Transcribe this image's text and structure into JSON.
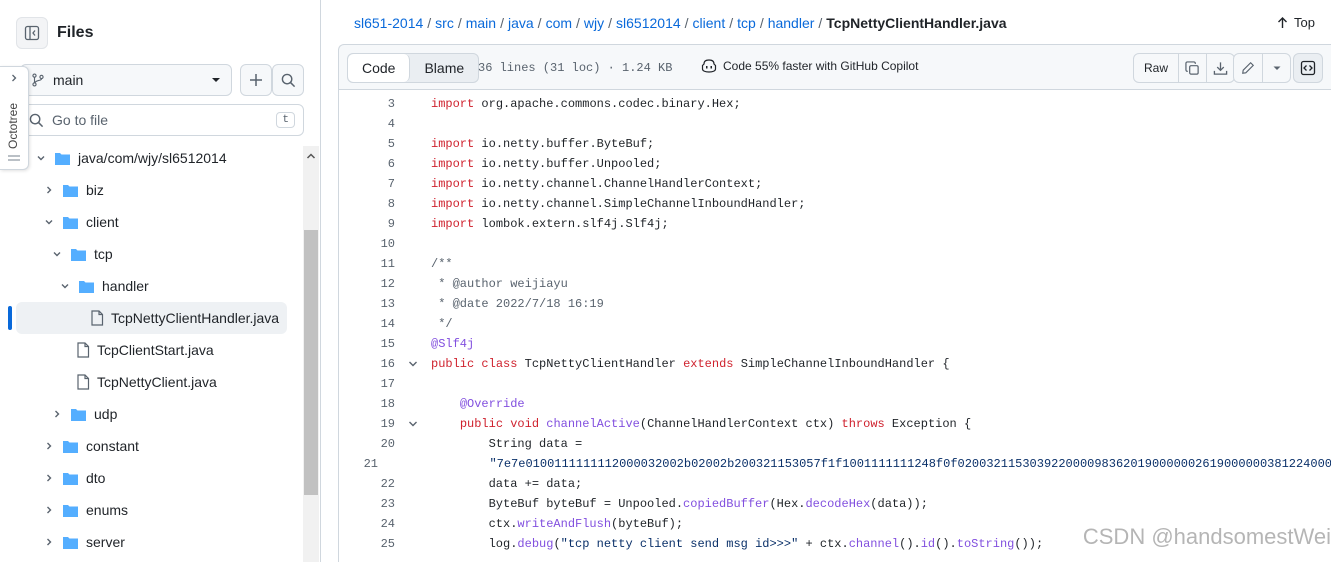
{
  "sidebar": {
    "title": "Files",
    "branch": "main",
    "search_placeholder": "Go to file",
    "search_shortcut": "t",
    "octotree_label": "Octotree",
    "tree": [
      {
        "label": "java/com/wjy/sl6512014",
        "type": "folder",
        "expanded": true
      },
      {
        "label": "biz",
        "type": "folder",
        "expanded": false
      },
      {
        "label": "client",
        "type": "folder",
        "expanded": true
      },
      {
        "label": "tcp",
        "type": "folder",
        "expanded": true
      },
      {
        "label": "handler",
        "type": "folder",
        "expanded": true
      },
      {
        "label": "TcpNettyClientHandler.java",
        "type": "file",
        "selected": true
      },
      {
        "label": "TcpClientStart.java",
        "type": "file"
      },
      {
        "label": "TcpNettyClient.java",
        "type": "file"
      },
      {
        "label": "udp",
        "type": "folder",
        "expanded": false
      },
      {
        "label": "constant",
        "type": "folder",
        "expanded": false
      },
      {
        "label": "dto",
        "type": "folder",
        "expanded": false
      },
      {
        "label": "enums",
        "type": "folder",
        "expanded": false
      },
      {
        "label": "server",
        "type": "folder",
        "expanded": false
      }
    ]
  },
  "breadcrumb": {
    "parts": [
      "sl651-2014",
      "src",
      "main",
      "java",
      "com",
      "wjy",
      "sl6512014",
      "client",
      "tcp",
      "handler"
    ],
    "current": "TcpNettyClientHandler.java",
    "top_label": "Top"
  },
  "toolbar": {
    "code_tab": "Code",
    "blame_tab": "Blame",
    "meta": "36 lines (31 loc) · 1.24 KB",
    "copilot": "Code 55% faster with GitHub Copilot",
    "raw_label": "Raw"
  },
  "code_lines": [
    {
      "n": "3",
      "text": "import org.apache.commons.codec.binary.Hex;"
    },
    {
      "n": "4",
      "text": ""
    },
    {
      "n": "5",
      "text": "import io.netty.buffer.ByteBuf;"
    },
    {
      "n": "6",
      "text": "import io.netty.buffer.Unpooled;"
    },
    {
      "n": "7",
      "text": "import io.netty.channel.ChannelHandlerContext;"
    },
    {
      "n": "8",
      "text": "import io.netty.channel.SimpleChannelInboundHandler;"
    },
    {
      "n": "9",
      "text": "import lombok.extern.slf4j.Slf4j;"
    },
    {
      "n": "10",
      "text": ""
    },
    {
      "n": "11",
      "text": "/**"
    },
    {
      "n": "12",
      "text": " * @author weijiayu"
    },
    {
      "n": "13",
      "text": " * @date 2022/7/18 16:19"
    },
    {
      "n": "14",
      "text": " */"
    },
    {
      "n": "15",
      "text": "@Slf4j"
    },
    {
      "n": "16",
      "text": "public class TcpNettyClientHandler extends SimpleChannelInboundHandler {"
    },
    {
      "n": "17",
      "text": ""
    },
    {
      "n": "18",
      "text": "    @Override"
    },
    {
      "n": "19",
      "text": "    public void channelActive(ChannelHandlerContext ctx) throws Exception {"
    },
    {
      "n": "20",
      "text": "        String data ="
    },
    {
      "n": "21",
      "text": "            \"7e7e0100111111112000032002b02002b200321153057f1f1001111111248f0f0200321153039220000983620190000002619000000381224000"
    },
    {
      "n": "22",
      "text": "        data += data;"
    },
    {
      "n": "23",
      "text": "        ByteBuf byteBuf = Unpooled.copiedBuffer(Hex.decodeHex(data));"
    },
    {
      "n": "24",
      "text": "        ctx.writeAndFlush(byteBuf);"
    },
    {
      "n": "25",
      "text": "        log.debug(\"tcp netty client send msg id>>>\" + ctx.channel().id().toString());"
    }
  ],
  "watermark": "CSDN @handsomestWei"
}
